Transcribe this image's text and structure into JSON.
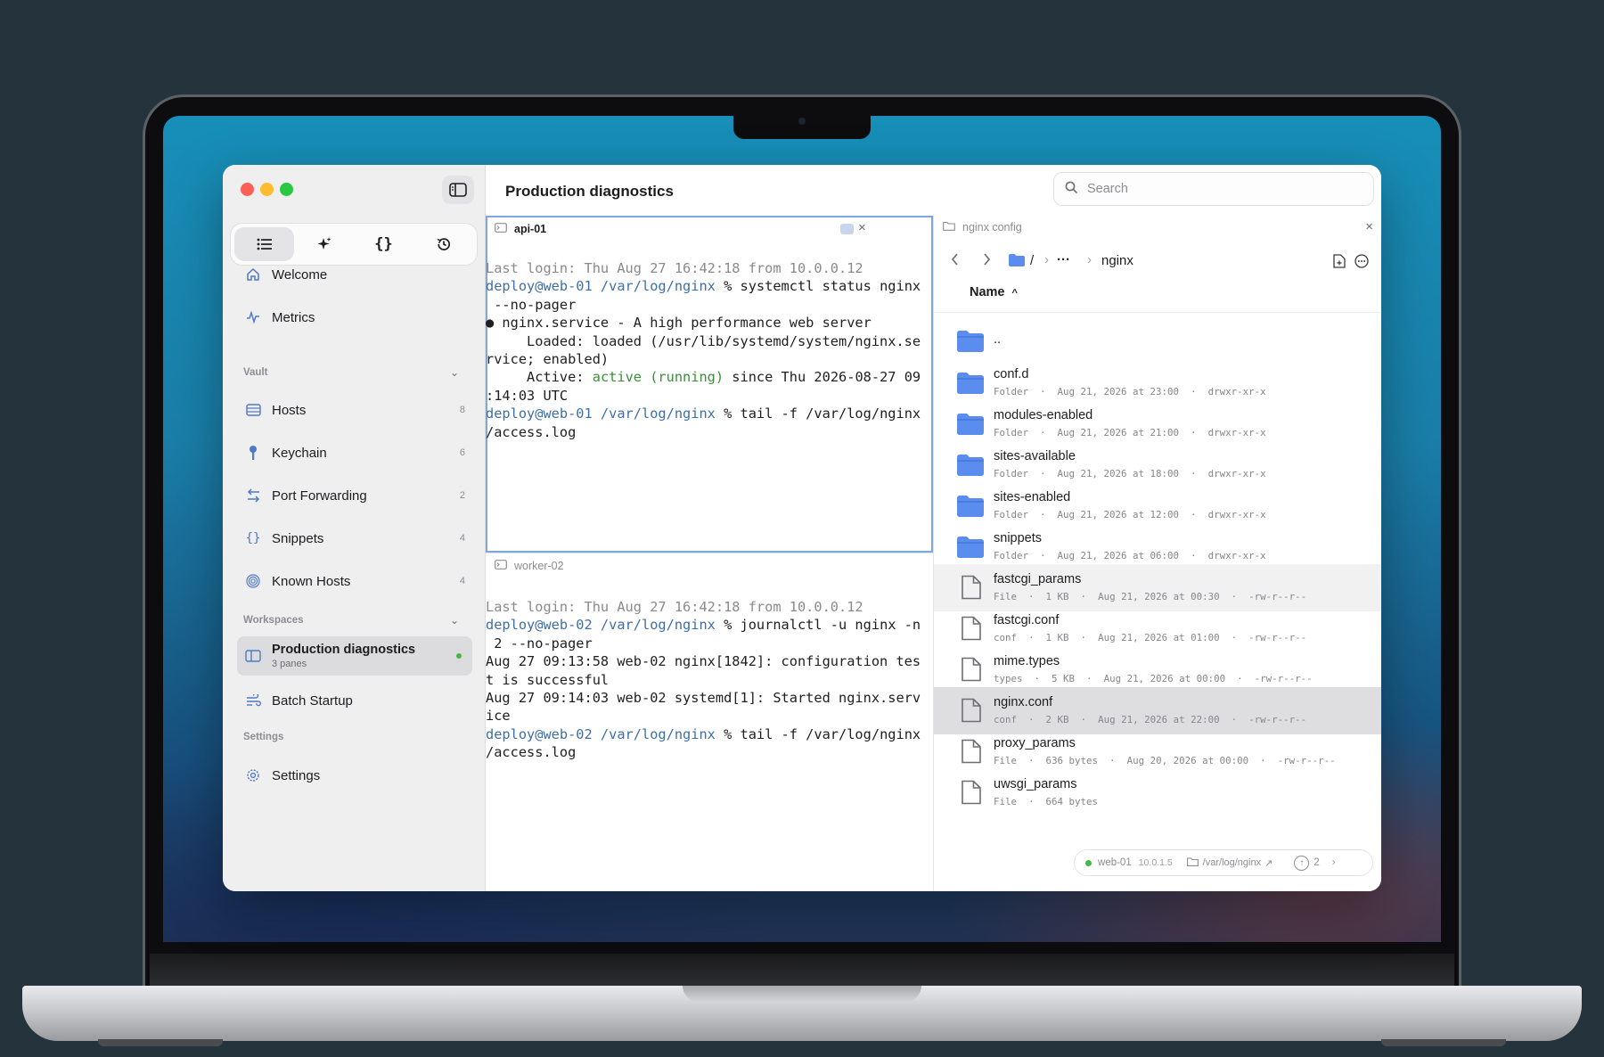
{
  "colors": {
    "accent": "#4f79c9",
    "folder": "#5b8def",
    "online": "#45b649"
  },
  "window": {
    "title": "Production diagnostics"
  },
  "search": {
    "placeholder": "Search"
  },
  "sidebar": {
    "segments": [
      "list-icon",
      "sparkle-icon",
      "braces-icon",
      "history-icon"
    ],
    "top_items": [
      {
        "label": "Welcome",
        "icon": "home-icon"
      },
      {
        "label": "Metrics",
        "icon": "pulse-icon"
      }
    ],
    "vault_header": "Vault",
    "vault_items": [
      {
        "label": "Hosts",
        "count": "8",
        "icon": "server-icon"
      },
      {
        "label": "Keychain",
        "count": "6",
        "icon": "key-icon"
      },
      {
        "label": "Port Forwarding",
        "count": "2",
        "icon": "arrows-icon"
      },
      {
        "label": "Snippets",
        "count": "4",
        "icon": "braces-icon"
      },
      {
        "label": "Known Hosts",
        "count": "4",
        "icon": "fingerprint-icon"
      }
    ],
    "workspaces_header": "Workspaces",
    "workspaces": [
      {
        "label": "Production diagnostics",
        "sub": "3 panes",
        "icon": "columns-icon"
      },
      {
        "label": "Batch Startup",
        "icon": "wind-icon"
      }
    ],
    "settings_header": "Settings",
    "settings_item": {
      "label": "Settings",
      "icon": "gear-icon"
    }
  },
  "pane1": {
    "title": "api-01",
    "lines": [
      "Last login: Thu Aug 27 16:42:18 from 10.0.0.12",
      "deploy@web-01 /var/log/nginx % systemctl status nginx",
      " --no-pager",
      "● nginx.service - A high performance web server",
      "     Loaded: loaded (/usr/lib/systemd/system/nginx.se",
      "rvice; enabled)",
      "     Active: active (running) since Thu 2026-08-27 09",
      ":14:03 UTC",
      "deploy@web-01 /var/log/nginx % tail -f /var/log/nginx",
      "/access.log"
    ]
  },
  "pane2": {
    "title": "worker-02",
    "lines": [
      "Last login: Thu Aug 27 16:42:18 from 10.0.0.12",
      "deploy@web-02 /var/log/nginx % journalctl -u nginx -n",
      " 2 --no-pager",
      "Aug 27 09:13:58 web-02 nginx[1842]: configuration tes",
      "t is successful",
      "Aug 27 09:14:03 web-02 systemd[1]: Started nginx.serv",
      "ice",
      "deploy@web-02 /var/log/nginx % tail -f /var/log/nginx",
      "/access.log"
    ]
  },
  "files": {
    "title": "nginx config",
    "path_root": "/",
    "path_ellipsis": "···",
    "path_current": "nginx",
    "column": "Name",
    "up": "..",
    "rows": [
      {
        "name": "conf.d",
        "type": "Folder",
        "size": "",
        "date": "Aug 21, 2026 at 23:00",
        "perm": "drwxr-xr-x",
        "kind": "folder"
      },
      {
        "name": "modules-enabled",
        "type": "Folder",
        "size": "",
        "date": "Aug 21, 2026 at 21:00",
        "perm": "drwxr-xr-x",
        "kind": "folder"
      },
      {
        "name": "sites-available",
        "type": "Folder",
        "size": "",
        "date": "Aug 21, 2026 at 18:00",
        "perm": "drwxr-xr-x",
        "kind": "folder"
      },
      {
        "name": "sites-enabled",
        "type": "Folder",
        "size": "",
        "date": "Aug 21, 2026 at 12:00",
        "perm": "drwxr-xr-x",
        "kind": "folder"
      },
      {
        "name": "snippets",
        "type": "Folder",
        "size": "",
        "date": "Aug 21, 2026 at 06:00",
        "perm": "drwxr-xr-x",
        "kind": "folder"
      },
      {
        "name": "fastcgi_params",
        "type": "File",
        "size": "1 KB",
        "date": "Aug 21, 2026 at 00:30",
        "perm": "-rw-r--r--",
        "kind": "file"
      },
      {
        "name": "fastcgi.conf",
        "type": "conf",
        "size": "1 KB",
        "date": "Aug 21, 2026 at 01:00",
        "perm": "-rw-r--r--",
        "kind": "file"
      },
      {
        "name": "mime.types",
        "type": "types",
        "size": "5 KB",
        "date": "Aug 21, 2026 at 00:00",
        "perm": "-rw-r--r--",
        "kind": "file"
      },
      {
        "name": "nginx.conf",
        "type": "conf",
        "size": "2 KB",
        "date": "Aug 21, 2026 at 22:00",
        "perm": "-rw-r--r--",
        "kind": "file"
      },
      {
        "name": "proxy_params",
        "type": "File",
        "size": "636 bytes",
        "date": "Aug 20, 2026 at 00:00",
        "perm": "-rw-r--r--",
        "kind": "file"
      },
      {
        "name": "uwsgi_params",
        "type": "File",
        "size": "664 bytes",
        "date": "",
        "perm": "",
        "kind": "file"
      }
    ]
  },
  "status": {
    "host": "web-01",
    "ip": "10.0.1.5",
    "path": "/var/log/nginx",
    "count": "2"
  }
}
